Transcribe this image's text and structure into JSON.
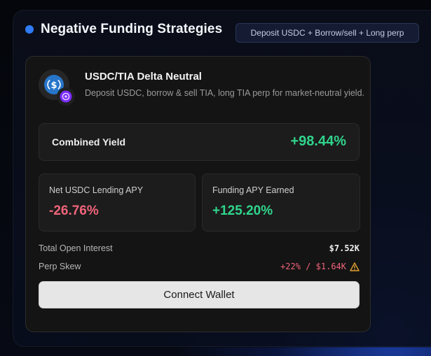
{
  "header": {
    "title": "Negative Funding Strategies",
    "badge": "Deposit USDC + Borrow/sell + Long perp",
    "dot_color": "#2f7bf5"
  },
  "strategy": {
    "title": "USDC/TIA Delta Neutral",
    "description": "Deposit USDC, borrow & sell TIA, long TIA perp for market-neutral yield.",
    "icons": [
      "usdc-icon",
      "tia-icon"
    ],
    "combined_yield": {
      "label": "Combined Yield",
      "value": "+98.44%"
    },
    "stats": [
      {
        "label": "Net USDC Lending APY",
        "value": "-26.76%"
      },
      {
        "label": "Funding APY Earned",
        "value": "+125.20%"
      }
    ],
    "total_open_interest": {
      "label": "Total Open Interest",
      "value": "$7.52K"
    },
    "perp_skew": {
      "label": "Perp Skew",
      "value": "+22% / $1.64K",
      "icon": "warning-icon"
    },
    "connect_label": "Connect Wallet"
  },
  "colors": {
    "positive": "#2fd58c",
    "negative": "#f0647a",
    "warning": "#e0a030",
    "usdc": "#2775ca",
    "tia": "#7b2bf9"
  }
}
